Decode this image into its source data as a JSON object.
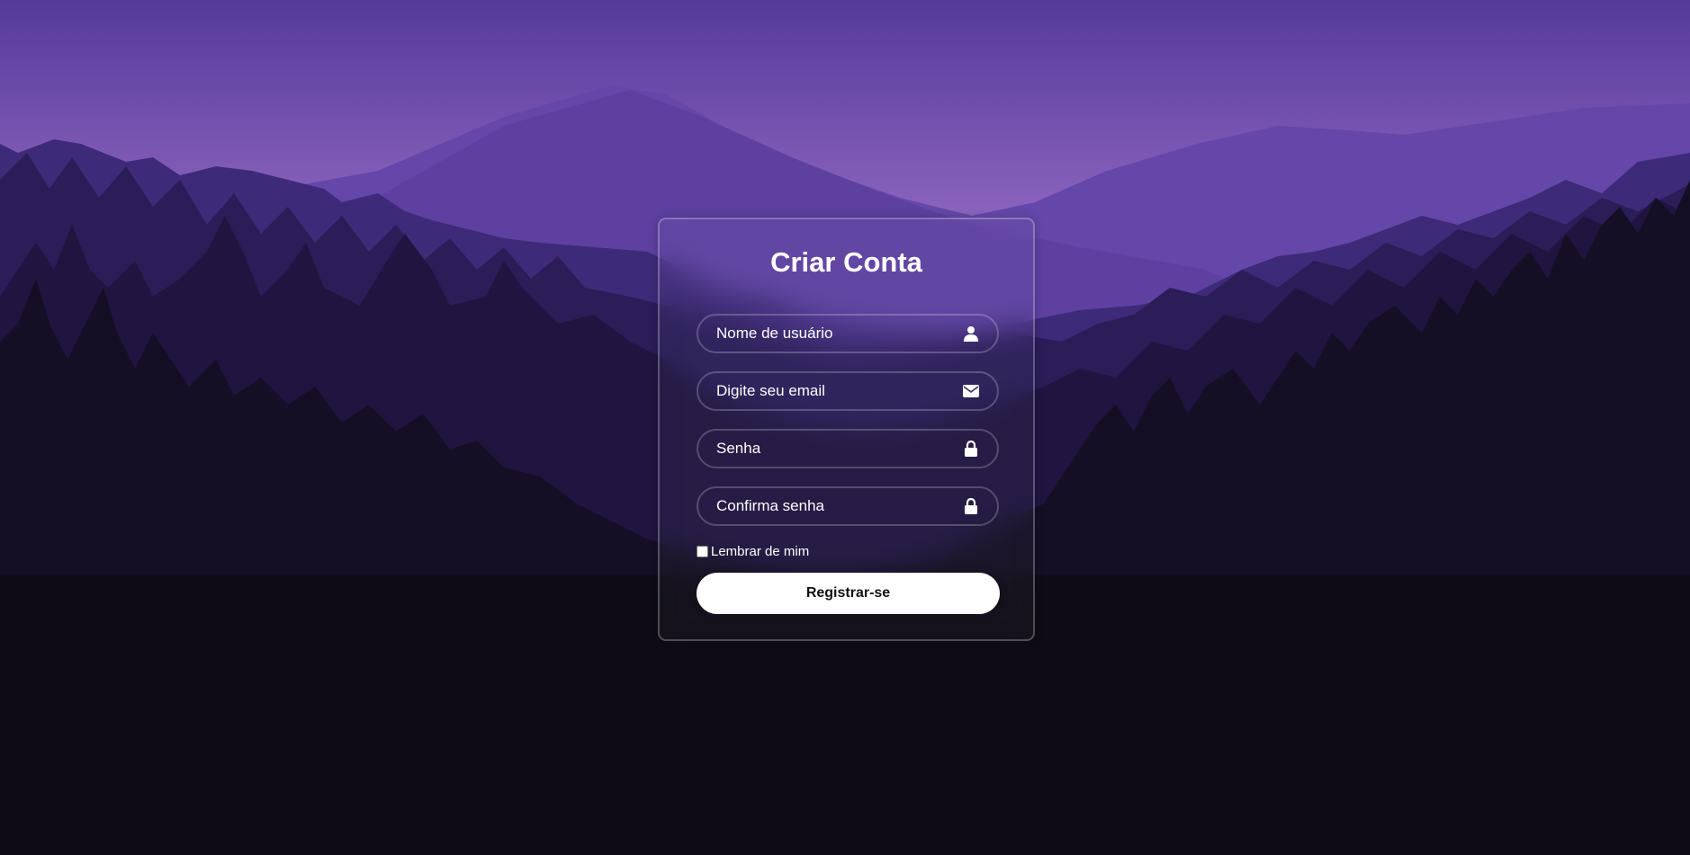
{
  "form": {
    "title": "Criar Conta",
    "username_placeholder": "Nome de usuário",
    "email_placeholder": "Digite seu email",
    "password_placeholder": "Senha",
    "confirm_placeholder": "Confirma senha",
    "remember_label": "Lembrar de mim",
    "remember_checked": false,
    "submit_label": "Registrar-se"
  },
  "icons": {
    "username": "user-icon",
    "email": "envelope-icon",
    "password": "lock-icon",
    "confirm": "lock-icon"
  },
  "colors": {
    "sky_top": "#5a3c9c",
    "sky_horizon": "#8a62bd",
    "forest_dark": "#0e0b16",
    "button_bg": "#ffffff",
    "text": "#ffffff"
  }
}
